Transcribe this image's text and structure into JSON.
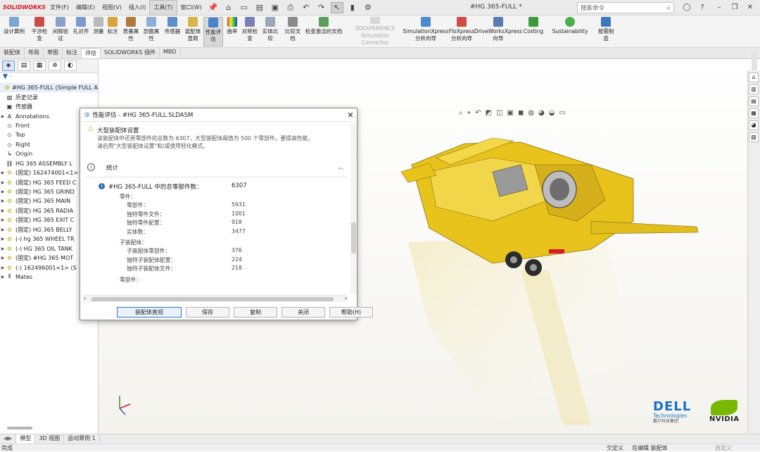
{
  "app": {
    "logo_text": "SOLIDWORKS",
    "document_title": "#HG 365-FULL *"
  },
  "menu": [
    "文件(F)",
    "编辑(E)",
    "视图(V)",
    "插入(I)",
    "工具(T)",
    "窗口(W)"
  ],
  "menu_active_index": 4,
  "search": {
    "placeholder": "搜索命令"
  },
  "command_manager": [
    {
      "label": "设计算例",
      "sub": ""
    },
    {
      "label": "干涉检",
      "sub": "查"
    },
    {
      "label": "间隙验",
      "sub": "证"
    },
    {
      "label": "孔对齐",
      "sub": ""
    },
    {
      "label": "测量",
      "sub": ""
    },
    {
      "label": "标注",
      "sub": ""
    },
    {
      "label": "质量属",
      "sub": "性"
    },
    {
      "label": "剖面属",
      "sub": "性"
    },
    {
      "label": "传感器",
      "sub": ""
    },
    {
      "label": "装配体",
      "sub": "直观"
    },
    {
      "label": "性能评",
      "sub": "估"
    },
    {
      "label": "曲率",
      "sub": ""
    },
    {
      "label": "对称检",
      "sub": "查"
    },
    {
      "label": "实体比",
      "sub": "较"
    },
    {
      "label": "比较文",
      "sub": "档"
    },
    {
      "label": "检查激活的文档",
      "sub": ""
    },
    {
      "label": "3DEXPERIENCE",
      "sub": "Simulation Connector"
    },
    {
      "label": "SimulationXpress",
      "sub": "分析向导"
    },
    {
      "label": "FloXpress",
      "sub": "分析向导"
    },
    {
      "label": "DriveWorksXpress",
      "sub": "向导"
    },
    {
      "label": "Costing",
      "sub": ""
    },
    {
      "label": "Sustainability",
      "sub": ""
    },
    {
      "label": "按需制",
      "sub": "造"
    }
  ],
  "ribbon_tabs": [
    "装配体",
    "布局",
    "草图",
    "标注",
    "评估",
    "SOLIDWORKS 插件",
    "MBD"
  ],
  "ribbon_active_tab": "评估",
  "tree": [
    {
      "label": "#HG 365-FULL (Simple FULL A",
      "icon": "assembly"
    },
    {
      "label": "历史记录",
      "icon": "history"
    },
    {
      "label": "传感器",
      "icon": "sensor"
    },
    {
      "label": "Annotations",
      "icon": "annotation"
    },
    {
      "label": "Front",
      "icon": "plane"
    },
    {
      "label": "Top",
      "icon": "plane"
    },
    {
      "label": "Right",
      "icon": "plane"
    },
    {
      "label": "Origin",
      "icon": "origin"
    },
    {
      "label": "HG 365 ASSEMBLY L",
      "icon": "link"
    },
    {
      "label": "(固定) 162474001<1>",
      "icon": "part"
    },
    {
      "label": "(固定) HG 365 FEED C",
      "icon": "part"
    },
    {
      "label": "(固定) HG 365 GRIND",
      "icon": "part"
    },
    {
      "label": "(固定) HG 365 MAIN",
      "icon": "part"
    },
    {
      "label": "(固定) HG 365 RADIA",
      "icon": "part"
    },
    {
      "label": "(固定) HG 365 EXIT C",
      "icon": "part"
    },
    {
      "label": "(固定) HG 365 BELLY",
      "icon": "part"
    },
    {
      "label": "(-) hg 365 WHEEL TR",
      "icon": "part"
    },
    {
      "label": "(-) HG 365 OIL TANK",
      "icon": "part"
    },
    {
      "label": "(固定) #HG 365 MOT",
      "icon": "part"
    },
    {
      "label": "(-) 162496001<1> (S",
      "icon": "part"
    },
    {
      "label": "Mates",
      "icon": "mates"
    }
  ],
  "dialog": {
    "title": "性能评估 - #HG 365-FULL.SLDASM",
    "warning_title": "大型装配体设置",
    "warning_text": "该装配体中还原零部件的总数为 6307，大型装配体阈值为 500 个零部件。要提高性能，请启用\"大型装配体设置\"和/或使用轻化模式。",
    "section_title": "统计",
    "total_label": "#HG 365-FULL 中的总零部件数：",
    "total_value": "6307",
    "rows": [
      {
        "label": "零件：",
        "value": "",
        "level": 1
      },
      {
        "label": "零部件：",
        "value": "5931",
        "level": 2
      },
      {
        "label": "独特零件文件：",
        "value": "1001",
        "level": 2
      },
      {
        "label": "独特零件配置：",
        "value": "918",
        "level": 2
      },
      {
        "label": "实体数：",
        "value": "3477",
        "level": 2
      },
      {
        "label": "子装配体：",
        "value": "",
        "level": 1
      },
      {
        "label": "子装配体零部件：",
        "value": "376",
        "level": 2
      },
      {
        "label": "独特子装配体配置：",
        "value": "224",
        "level": 2
      },
      {
        "label": "独特子装配体文件：",
        "value": "218",
        "level": 2
      },
      {
        "label": "零部件：",
        "value": "",
        "level": 1
      }
    ],
    "buttons": [
      "装配体直观",
      "保存",
      "复制",
      "关闭",
      "帮助(H)"
    ]
  },
  "bottom_tabs": [
    "模型",
    "3D 视图",
    "运动算例 1"
  ],
  "status": {
    "left": "完成",
    "middle": "欠定义",
    "right": "在编辑 装配体",
    "far_right": "自定义"
  },
  "brands": {
    "dell": "DELL",
    "dell_sub": "Technologies",
    "dell_sub2": "戴尔科技集团",
    "nvidia": "NVIDIA"
  },
  "colors": {
    "accent_blue": "#2b78c9",
    "machine_yellow": "#e8c31c",
    "brand_red": "#d6192b"
  }
}
